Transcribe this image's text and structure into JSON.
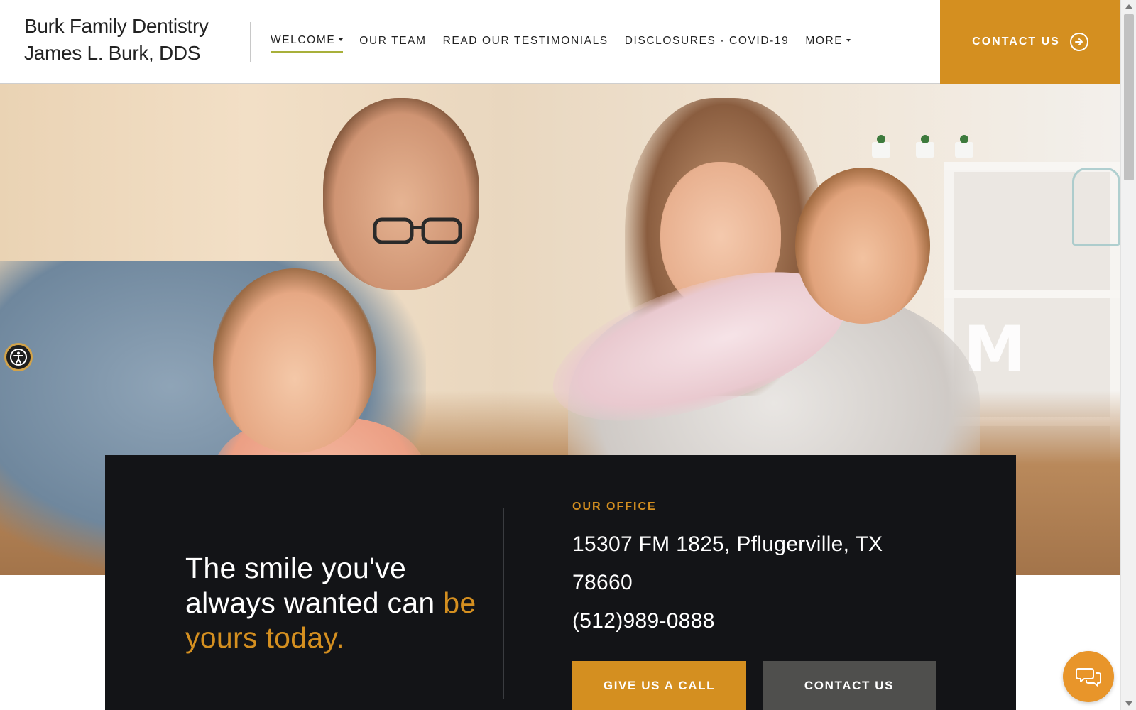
{
  "header": {
    "brand_line1": "Burk Family Dentistry",
    "brand_line2": "James L. Burk, DDS",
    "nav": [
      {
        "label": "WELCOME",
        "has_dropdown": true,
        "active": true
      },
      {
        "label": "OUR TEAM",
        "has_dropdown": false,
        "active": false
      },
      {
        "label": "READ OUR TESTIMONIALS",
        "has_dropdown": false,
        "active": false
      },
      {
        "label": "DISCLOSURES - COVID-19",
        "has_dropdown": false,
        "active": false
      },
      {
        "label": "MORE",
        "has_dropdown": true,
        "active": false
      }
    ],
    "contact_label": "CONTACT US"
  },
  "hero": {
    "image": "family-playing-photo",
    "accessibility_icon": "accessibility-icon"
  },
  "info": {
    "tagline_main": "The smile you've always wanted can ",
    "tagline_accent": "be yours today.",
    "office_label": "OUR OFFICE",
    "address": "15307 FM 1825, Pflugerville, TX 78660",
    "phone": "(512)989-0888",
    "call_button": "GIVE US A CALL",
    "contact_button": "CONTACT US"
  },
  "chat": {
    "icon": "chat-icon"
  },
  "colors": {
    "accent": "#d48f20",
    "panel": "#131417",
    "secondary_button": "#4f4f4d",
    "nav_underline": "#a8b03a"
  }
}
